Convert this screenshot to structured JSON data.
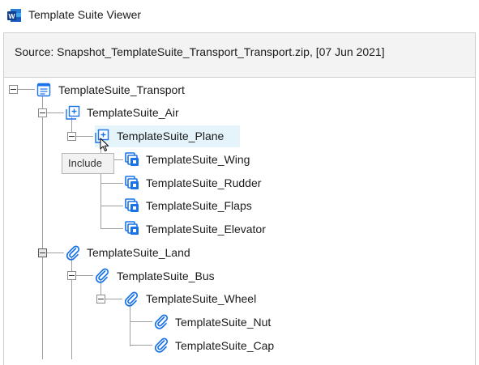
{
  "window": {
    "title": "Template Suite Viewer",
    "app_icon": "word-icon"
  },
  "source": {
    "text": "Source: Snapshot_TemplateSuite_Transport_Transport.zip, [07 Jun 2021]"
  },
  "tree": {
    "root": {
      "label": "TemplateSuite_Transport",
      "icon": "document-icon"
    },
    "air": {
      "label": "TemplateSuite_Air",
      "icon": "include-icon"
    },
    "plane": {
      "label": "TemplateSuite_Plane",
      "icon": "include-icon"
    },
    "wing": {
      "label": "TemplateSuite_Wing",
      "icon": "copy-icon"
    },
    "rudder": {
      "label": "TemplateSuite_Rudder",
      "icon": "copy-icon"
    },
    "flaps": {
      "label": "TemplateSuite_Flaps",
      "icon": "copy-icon"
    },
    "elevator": {
      "label": "TemplateSuite_Elevator",
      "icon": "copy-icon"
    },
    "land": {
      "label": "TemplateSuite_Land",
      "icon": "paperclip-icon"
    },
    "bus": {
      "label": "TemplateSuite_Bus",
      "icon": "paperclip-icon"
    },
    "wheel": {
      "label": "TemplateSuite_Wheel",
      "icon": "paperclip-icon"
    },
    "nut": {
      "label": "TemplateSuite_Nut",
      "icon": "paperclip-icon"
    },
    "cap": {
      "label": "TemplateSuite_Cap",
      "icon": "paperclip-icon"
    }
  },
  "tooltip": {
    "text": "Include"
  },
  "colors": {
    "accent": "#1a73e8",
    "selection": "#e5f3fb",
    "word_blue": "#2b579a"
  }
}
